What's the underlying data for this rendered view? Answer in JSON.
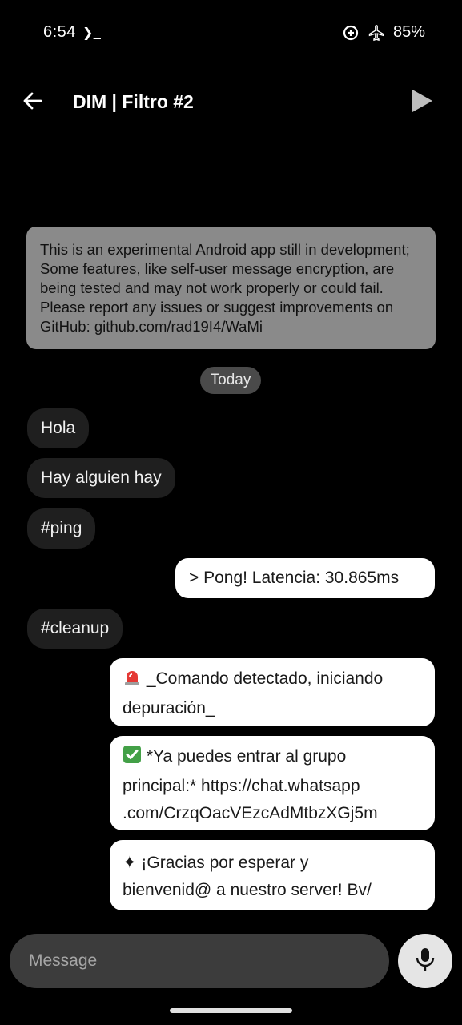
{
  "status_bar": {
    "time": "6:54",
    "terminal_glyph": "❯_",
    "icons": [
      "data-saver-icon",
      "airplane-icon"
    ],
    "battery": "85%"
  },
  "header": {
    "title": "DIM | Filtro #2",
    "back_icon": "arrow-left-icon",
    "send_icon": "play-icon"
  },
  "notice": {
    "text": "This is an experimental Android app still in development; Some features, like self-user message encryption, are being tested and may not work properly or could fail. Please report any issues or suggest improvements on GitHub: ",
    "link": "github.com/rad19I4/WaMi"
  },
  "date_chip": "Today",
  "messages": [
    {
      "direction": "in",
      "text": "Hola"
    },
    {
      "direction": "in",
      "text": "Hay alguien hay"
    },
    {
      "direction": "in",
      "text": "#ping"
    },
    {
      "direction": "out",
      "text": "> Pong! Latencia: 30.865ms"
    },
    {
      "direction": "in",
      "text": "#cleanup"
    },
    {
      "direction": "out",
      "emoji": "siren-emoji",
      "line1": " _Comando detectado, iniciando",
      "line2": "depuración_"
    },
    {
      "direction": "out",
      "emoji": "check-mark-emoji",
      "line1": " *Ya puedes entrar al grupo",
      "line2": "principal:* https://chat.whatsapp",
      "line3": ".com/CrzqOacVEzcAdMtbzXGj5m"
    },
    {
      "direction": "out",
      "emoji": "sparkle-emoji",
      "line1": "✦ ¡Gracias por esperar y",
      "line2": "bienvenid@ a nuestro server! Bv/"
    }
  ],
  "composer": {
    "placeholder": "Message",
    "mic_icon": "microphone-icon"
  },
  "colors": {
    "background": "#000000",
    "incoming_bubble": "#1f1f1f",
    "outgoing_bubble": "#ffffff",
    "notice_bubble": "#8a8a8a",
    "composer": "#3c3c3c"
  }
}
